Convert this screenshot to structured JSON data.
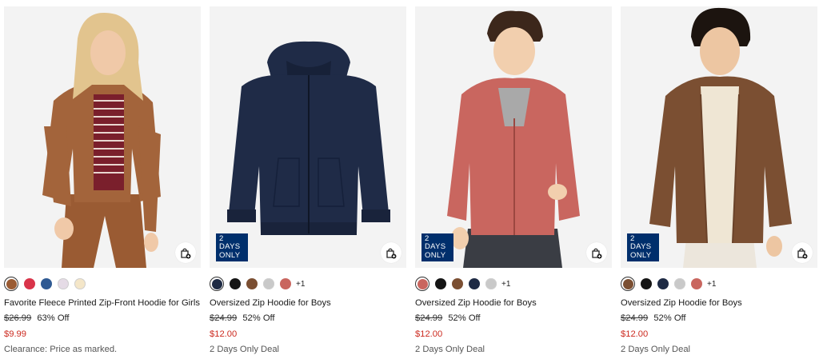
{
  "products": [
    {
      "name": "Favorite Fleece Printed Zip-Front Hoodie for Girls",
      "original_price": "$26.99",
      "discount": "63% Off",
      "sale_price": "$9.99",
      "promo": "Clearance: Price as marked.",
      "badge": null,
      "more_colors": null,
      "swatches": [
        "#9a5b33",
        "#d9344a",
        "#2f5a93",
        "#e5dbe6",
        "#f4e6c8"
      ],
      "selected_swatch": 0,
      "bag_icon": "add-to-bag-icon"
    },
    {
      "name": "Oversized Zip Hoodie for Boys",
      "original_price": "$24.99",
      "discount": "52% Off",
      "sale_price": "$12.00",
      "promo": "2 Days Only Deal",
      "badge": {
        "line1": "2 DAYS",
        "line2": "ONLY"
      },
      "more_colors": "+1",
      "swatches": [
        "#1e2a44",
        "#151515",
        "#7b4f32",
        "#c9c9c9",
        "#c9665f"
      ],
      "selected_swatch": 0,
      "bag_icon": "add-to-bag-icon"
    },
    {
      "name": "Oversized Zip Hoodie for Boys",
      "original_price": "$24.99",
      "discount": "52% Off",
      "sale_price": "$12.00",
      "promo": "2 Days Only Deal",
      "badge": {
        "line1": "2 DAYS",
        "line2": "ONLY"
      },
      "more_colors": "+1",
      "swatches": [
        "#c9665f",
        "#151515",
        "#7b4f32",
        "#1e2a44",
        "#c9c9c9"
      ],
      "selected_swatch": 0,
      "bag_icon": "add-to-bag-icon"
    },
    {
      "name": "Oversized Zip Hoodie for Boys",
      "original_price": "$24.99",
      "discount": "52% Off",
      "sale_price": "$12.00",
      "promo": "2 Days Only Deal",
      "badge": {
        "line1": "2 DAYS",
        "line2": "ONLY"
      },
      "more_colors": "+1",
      "swatches": [
        "#7b4f32",
        "#151515",
        "#1e2a44",
        "#c9c9c9",
        "#c9665f"
      ],
      "selected_swatch": 0,
      "bag_icon": "add-to-bag-icon"
    }
  ],
  "colors": {
    "sale_red": "#cc2a1f",
    "badge_navy": "#002f6c",
    "image_bg": "#f3f3f3"
  }
}
